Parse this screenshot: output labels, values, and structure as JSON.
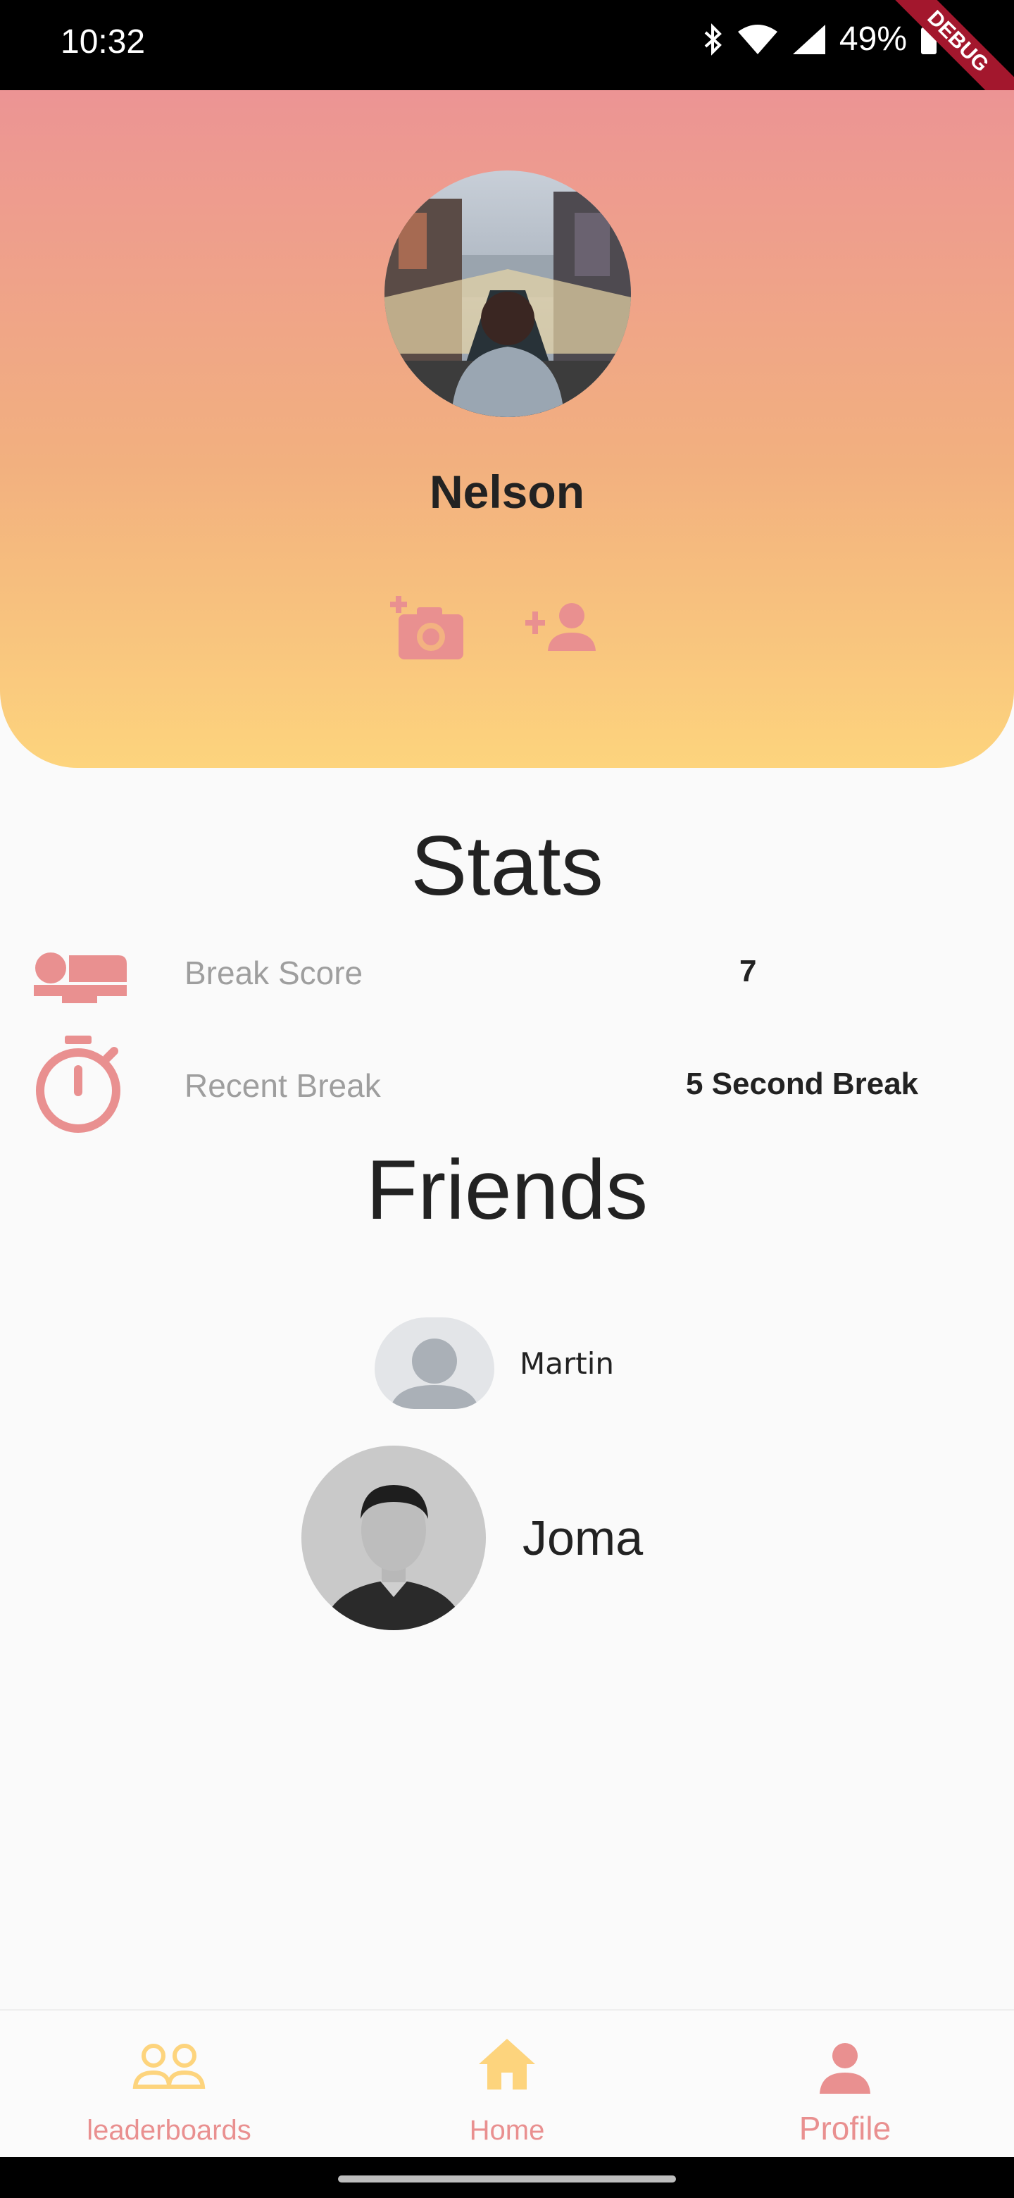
{
  "status_bar": {
    "time": "10:32",
    "battery": "49%"
  },
  "debug_banner": "DEBUG",
  "profile": {
    "name": "Nelson",
    "avatar": "street-canal-photo",
    "actions": [
      {
        "icon": "add-photo-icon"
      },
      {
        "icon": "add-friend-icon"
      }
    ]
  },
  "stats": {
    "title": "Stats",
    "items": [
      {
        "icon": "bed-icon",
        "label": "Break Score",
        "value": "7"
      },
      {
        "icon": "stopwatch-icon",
        "label": "Recent Break",
        "value": "5 Second Break"
      }
    ]
  },
  "friends": {
    "title": "Friends",
    "items": [
      {
        "name": "Martin",
        "avatar": "default-avatar"
      },
      {
        "name": "Joma",
        "avatar": "portrait-photo"
      }
    ]
  },
  "nav": {
    "items": [
      {
        "label": "leaderboards",
        "icon": "people-icon",
        "color": "#e99090"
      },
      {
        "label": "Home",
        "icon": "home-icon",
        "color": "#e99090"
      },
      {
        "label": "Profile",
        "icon": "person-icon",
        "color": "#e99090"
      }
    ]
  },
  "colors": {
    "accent_pink": "#e99090",
    "accent_yellow": "#fdd47d"
  }
}
